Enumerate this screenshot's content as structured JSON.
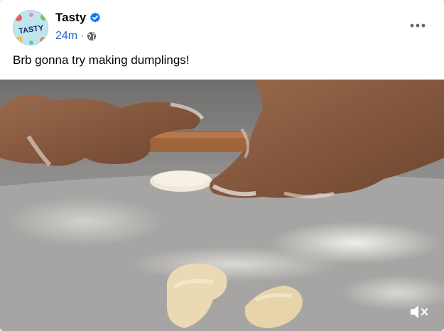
{
  "post": {
    "page_name": "Tasty",
    "verified": true,
    "time": "24m",
    "separator": "·",
    "audience_icon": "globe-icon",
    "caption": "Brb gonna try making dumplings!",
    "avatar_text": "TASTY",
    "more_icon": "more-options-icon"
  },
  "video": {
    "muted": true,
    "mute_icon": "speaker-muted-icon"
  },
  "colors": {
    "accent": "#1877f2",
    "text_primary": "#050505",
    "text_secondary": "#65676b"
  }
}
